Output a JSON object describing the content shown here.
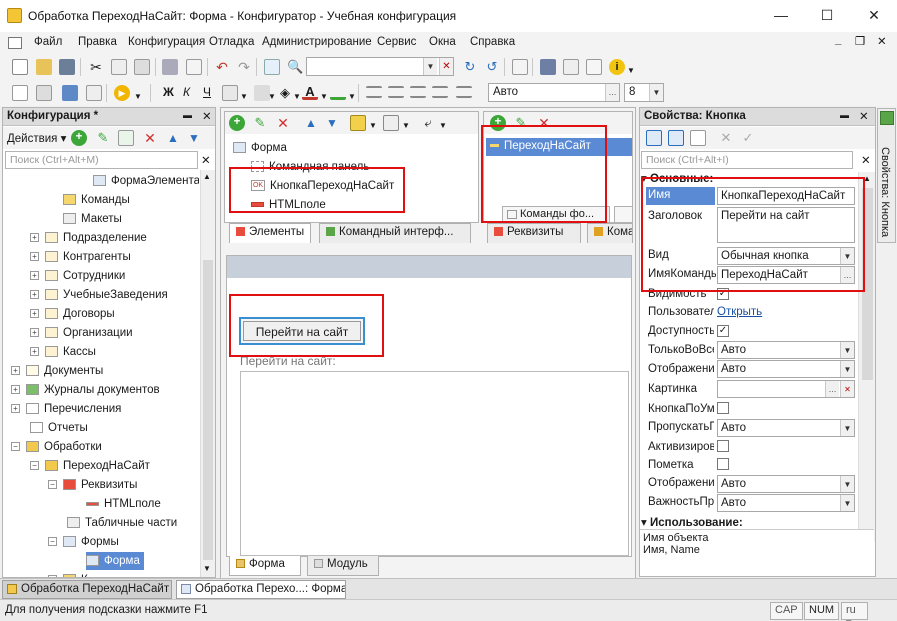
{
  "window": {
    "title": "Обработка ПереходНаСайт: Форма - Конфигуратор - Учебная конфигурация",
    "controls": {
      "minimize": "—",
      "maximize": "☐",
      "close": "✕"
    }
  },
  "menu": {
    "items": [
      "Файл",
      "Правка",
      "Конфигурация",
      "Отладка",
      "Администрирование",
      "Сервис",
      "Окна",
      "Справка"
    ],
    "window_controls": {
      "minimize": "_",
      "restore": "❐",
      "close": "✕"
    }
  },
  "toolbar2": {
    "bold": "Ж",
    "italic": "К",
    "underline": "Ч",
    "font_value": "Авто",
    "size_value": "8"
  },
  "config_panel": {
    "title": "Конфигурация *",
    "actions_label": "Действия",
    "search_placeholder": "Поиск (Ctrl+Alt+M)",
    "tree": [
      {
        "label": "ФормаЭлемента",
        "indent": 90,
        "icon": "form-icon",
        "expander": ""
      },
      {
        "label": "Команды",
        "indent": 60,
        "icon": "command-icon",
        "expander": ""
      },
      {
        "label": "Макеты",
        "indent": 60,
        "icon": "template-icon",
        "expander": ""
      },
      {
        "label": "Подразделение",
        "indent": 27,
        "icon": "catalog-icon",
        "expander": "+"
      },
      {
        "label": "Контрагенты",
        "indent": 27,
        "icon": "catalog-icon",
        "expander": "+"
      },
      {
        "label": "Сотрудники",
        "indent": 27,
        "icon": "catalog-icon",
        "expander": "+"
      },
      {
        "label": "УчебныеЗаведения",
        "indent": 27,
        "icon": "catalog-icon",
        "expander": "+"
      },
      {
        "label": "Договоры",
        "indent": 27,
        "icon": "catalog-icon",
        "expander": "+"
      },
      {
        "label": "Организации",
        "indent": 27,
        "icon": "catalog-icon",
        "expander": "+"
      },
      {
        "label": "Кассы",
        "indent": 27,
        "icon": "catalog-icon",
        "expander": "+"
      },
      {
        "label": "Документы",
        "indent": 8,
        "icon": "documents-icon",
        "expander": "+"
      },
      {
        "label": "Журналы документов",
        "indent": 8,
        "icon": "journal-icon",
        "expander": "+"
      },
      {
        "label": "Перечисления",
        "indent": 8,
        "icon": "enum-icon",
        "expander": "+"
      },
      {
        "label": "Отчеты",
        "indent": 27,
        "icon": "report-icon",
        "expander": ""
      },
      {
        "label": "Обработки",
        "indent": 8,
        "icon": "dataprocessor-icon",
        "expander": "−"
      },
      {
        "label": "ПереходНаСайт",
        "indent": 27,
        "icon": "dataprocessor-icon",
        "expander": "−"
      },
      {
        "label": "Реквизиты",
        "indent": 45,
        "icon": "attributes-icon",
        "expander": "−"
      },
      {
        "label": "HTMLполе",
        "indent": 83,
        "icon": "attribute-icon",
        "expander": ""
      },
      {
        "label": "Табличные части",
        "indent": 64,
        "icon": "table-icon",
        "expander": ""
      },
      {
        "label": "Формы",
        "indent": 45,
        "icon": "forms-icon",
        "expander": "−"
      },
      {
        "label": "Форма",
        "indent": 83,
        "icon": "form-icon",
        "expander": "",
        "selected": true
      },
      {
        "label": "К",
        "indent": 45,
        "icon": "commands-icon",
        "expander": "+"
      }
    ]
  },
  "elements_panel": {
    "tree": [
      {
        "label": "Форма",
        "indent": 8
      },
      {
        "label": "Командная панель",
        "indent": 26
      },
      {
        "label": "КнопкаПереходНаСайт",
        "indent": 26
      },
      {
        "label": "HTMLполе",
        "indent": 26
      }
    ],
    "tabs": [
      "Элементы",
      "Командный интерф..."
    ]
  },
  "attributes_panel": {
    "item": "ПереходНаСайт",
    "bottom_tab": "Команды фо...",
    "tabs": [
      "Реквизиты",
      "Команды"
    ]
  },
  "form_preview": {
    "button_label": "Перейти на сайт",
    "field_caption": "Перейти на сайт:",
    "tabs": [
      "Форма",
      "Модуль"
    ]
  },
  "properties_panel": {
    "title": "Свойства: Кнопка",
    "search_placeholder": "Поиск (Ctrl+Alt+I)",
    "side_tab": "Свойства: Кнопка",
    "section_main": "Основные:",
    "section_usage": "Использование:",
    "rows": {
      "name_label": "Имя",
      "name_value": "КнопкаПереходНаСайт",
      "title_label": "Заголовок",
      "title_value": "Перейти на сайт",
      "view_label": "Вид",
      "view_value": "Обычная кнопка",
      "cmd_label": "ИмяКоманды",
      "cmd_value": "ПереходНаСайт",
      "visibility_label": "Видимость",
      "user_label": "Пользовательская видимость",
      "user_link": "Открыть",
      "enabled_label": "Доступность",
      "only_all_label": "ТолькоВоВсехДействиях",
      "only_all_value": "Авто",
      "display_label": "Отображение",
      "display_value": "Авто",
      "picture_label": "Картинка",
      "picture_value": "",
      "default_btn_label": "КнопкаПоУмолчанию",
      "skip_label": "ПропускатьПриВводе",
      "skip_value": "Авто",
      "activate_label": "Активизировать",
      "mark_label": "Пометка",
      "display_in_label": "ОтображениеВ",
      "display_in_value": "Авто",
      "importance_label": "ВажностьПриОтображении",
      "importance_value": "Авто"
    },
    "usage_lines": [
      "Имя объекта",
      "Имя, Name"
    ]
  },
  "window_tabs": [
    "Обработка ПереходНаСайт",
    "Обработка Перехо...: Форма"
  ],
  "status": {
    "hint": "Для получения подсказки нажмите F1",
    "cap": "CAP",
    "num": "NUM",
    "lang": "ru"
  }
}
